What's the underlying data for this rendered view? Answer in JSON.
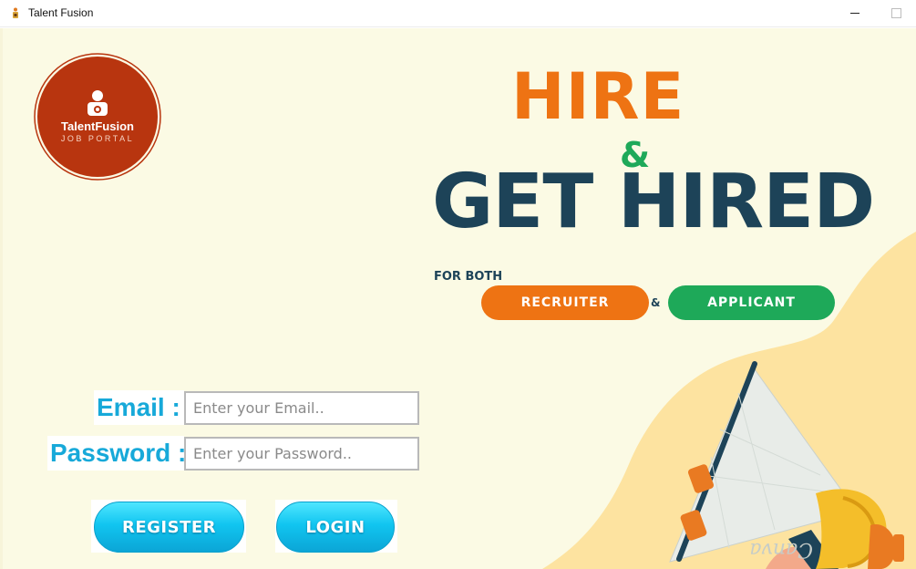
{
  "window": {
    "title": "Talent Fusion"
  },
  "logo": {
    "title": "TalentFusion",
    "subtitle": "JOB PORTAL"
  },
  "hero": {
    "line1": "HIRE",
    "ampersand": "&",
    "line2": "GET HIRED",
    "for_both": "FOR BOTH",
    "recruiter": "RECRUITER",
    "joiner": "&",
    "applicant": "APPLICANT"
  },
  "form": {
    "email_label": "Email :",
    "email_placeholder": "Enter your Email..",
    "password_label": "Password :",
    "password_placeholder": "Enter your Password..",
    "register_label": "REGISTER",
    "login_label": "LOGIN"
  },
  "colors": {
    "background": "#fbfae4",
    "accent_orange": "#ee7313",
    "accent_green": "#1ea959",
    "navy": "#1d4358",
    "label_blue": "#17a9d9",
    "logo_red": "#b8350f",
    "wave_yellow": "#fde3a0"
  },
  "icons": {
    "app": "person-icon",
    "logo_badge": "person-badge-icon",
    "illustration": "megaphone-icon"
  }
}
